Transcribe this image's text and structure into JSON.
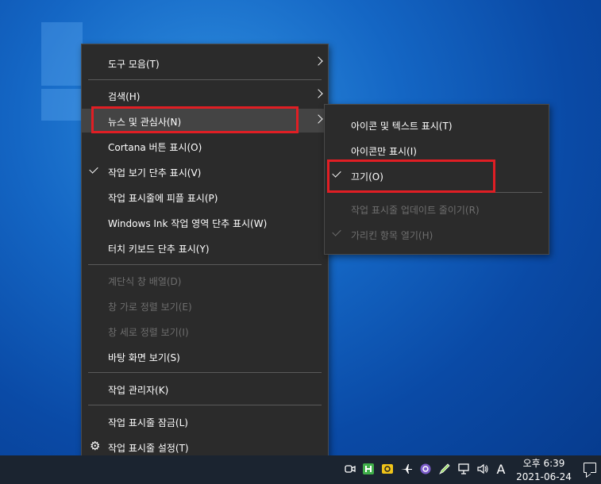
{
  "main_menu": {
    "items": [
      {
        "label": "도구 모음(T)"
      },
      {
        "label": "검색(H)"
      },
      {
        "label": "뉴스 및 관심사(N)"
      },
      {
        "label": "Cortana 버튼 표시(O)"
      },
      {
        "label": "작업 보기 단추 표시(V)"
      },
      {
        "label": "작업 표시줄에 피플 표시(P)"
      },
      {
        "label": "Windows Ink 작업 영역 단추 표시(W)"
      },
      {
        "label": "터치 키보드 단추 표시(Y)"
      },
      {
        "label": "계단식 창 배열(D)"
      },
      {
        "label": "창 가로 정렬 보기(E)"
      },
      {
        "label": "창 세로 정렬 보기(I)"
      },
      {
        "label": "바탕 화면 보기(S)"
      },
      {
        "label": "작업 관리자(K)"
      },
      {
        "label": "작업 표시줄 잠금(L)"
      },
      {
        "label": "작업 표시줄 설정(T)"
      }
    ]
  },
  "submenu": {
    "items": [
      {
        "label": "아이콘 및 텍스트 표시(T)"
      },
      {
        "label": "아이콘만 표시(I)"
      },
      {
        "label": "끄기(O)"
      },
      {
        "label": "작업 표시줄 업데이트 줄이기(R)"
      },
      {
        "label": "가리킨 항목 열기(H)"
      }
    ]
  },
  "tray": {
    "ime_label": "A",
    "time": "오후 6:39",
    "date": "2021-06-24"
  },
  "colors": {
    "menu_bg": "#2b2b2b",
    "highlight": "#444444",
    "annotation_red": "#e01e24",
    "taskbar": "#1b2430"
  }
}
